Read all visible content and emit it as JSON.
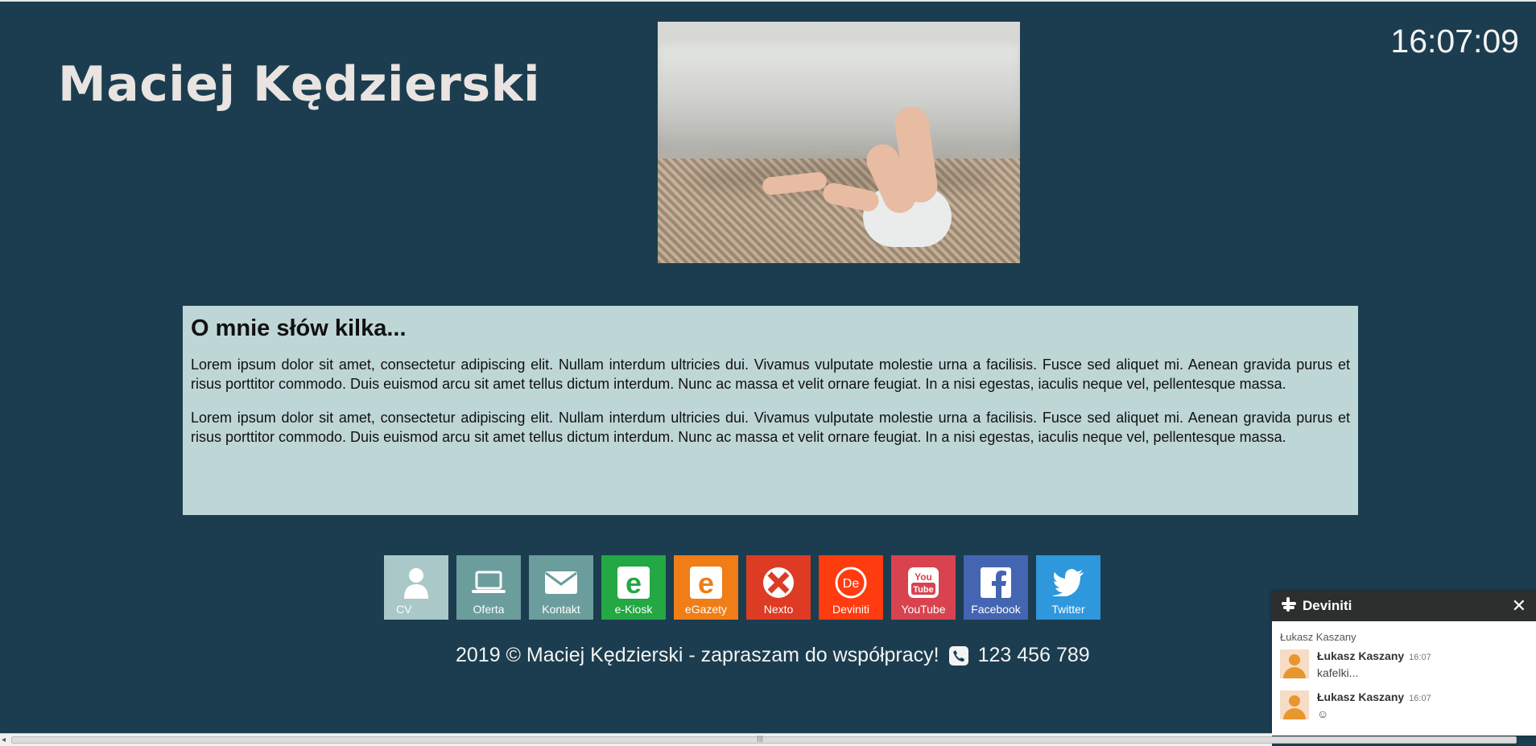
{
  "header": {
    "site_title": "Maciej Kędzierski",
    "clock": "16:07:09"
  },
  "about": {
    "heading": "O mnie słów kilka...",
    "paragraphs": [
      "Lorem ipsum dolor sit amet, consectetur adipiscing elit. Nullam interdum ultricies dui. Vivamus vulputate molestie urna a facilisis. Fusce sed aliquet mi. Aenean gravida purus et risus porttitor commodo. Duis euismod arcu sit amet tellus dictum interdum. Nunc ac massa et velit ornare feugiat. In a nisi egestas, iaculis neque vel, pellentesque massa.",
      "Lorem ipsum dolor sit amet, consectetur adipiscing elit. Nullam interdum ultricies dui. Vivamus vulputate molestie urna a facilisis. Fusce sed aliquet mi. Aenean gravida purus et risus porttitor commodo. Duis euismod arcu sit amet tellus dictum interdum. Nunc ac massa et velit ornare feugiat. In a nisi egestas, iaculis neque vel, pellentesque massa."
    ]
  },
  "tiles": [
    {
      "label": "CV",
      "icon": "user-icon",
      "color": "#a9c8c7"
    },
    {
      "label": "Oferta",
      "icon": "laptop-icon",
      "color": "#6b9d9c"
    },
    {
      "label": "Kontakt",
      "icon": "envelope-icon",
      "color": "#6b9d9c"
    },
    {
      "label": "e-Kiosk",
      "icon": "ekiosk-icon",
      "color": "#23a843"
    },
    {
      "label": "eGazety",
      "icon": "egazety-icon",
      "color": "#f07d16"
    },
    {
      "label": "Nexto",
      "icon": "nexto-icon",
      "color": "#dd3b24"
    },
    {
      "label": "Deviniti",
      "icon": "deviniti-icon",
      "color": "#ff3b10"
    },
    {
      "label": "YouTube",
      "icon": "youtube-icon",
      "color": "#d8434f"
    },
    {
      "label": "Facebook",
      "icon": "facebook-icon",
      "color": "#4465b1"
    },
    {
      "label": "Twitter",
      "icon": "twitter-icon",
      "color": "#2f97dc"
    }
  ],
  "footer": {
    "text": "2019 © Maciej Kędzierski - zapraszam do współpracy!",
    "phone": "123 456 789"
  },
  "chat": {
    "title": "Deviniti",
    "agent": "Łukasz Kaszany",
    "messages": [
      {
        "author": "Łukasz Kaszany",
        "time": "16:07",
        "text": "kafelki..."
      },
      {
        "author": "Łukasz Kaszany",
        "time": "16:07",
        "text": "☺"
      }
    ]
  }
}
